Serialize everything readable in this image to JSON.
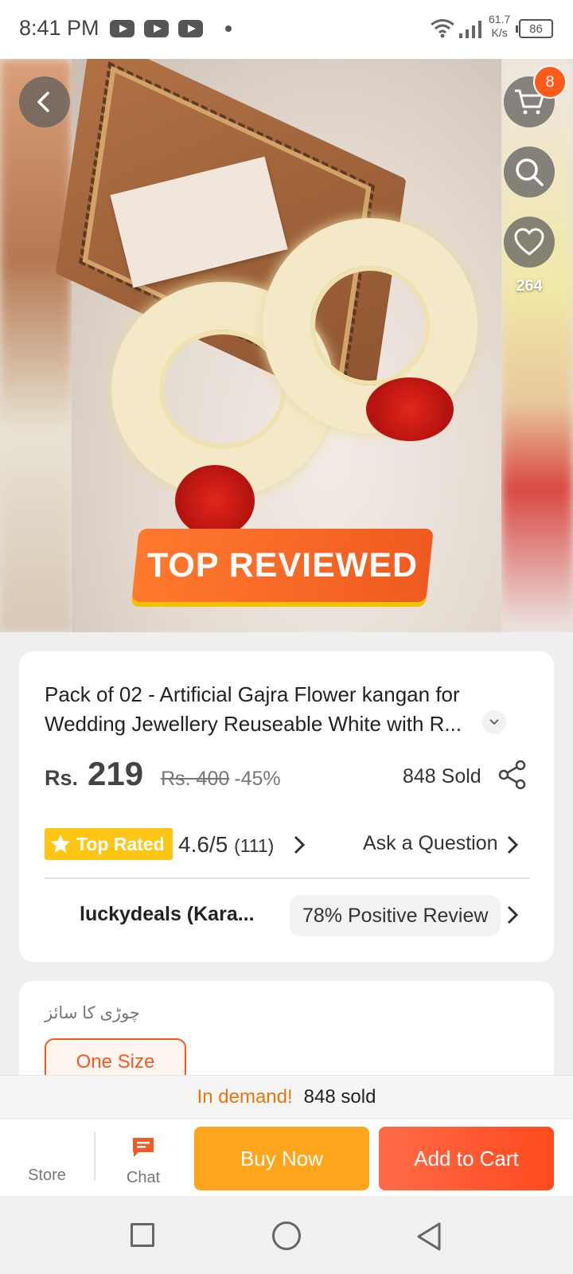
{
  "status_bar": {
    "time": "8:41 PM",
    "net_speed_value": "61.7",
    "net_speed_unit": "K/s",
    "battery": "86"
  },
  "hero": {
    "badge_text": "TOP REVIEWED",
    "cart_count": "8",
    "favorites_count": "264"
  },
  "product": {
    "title_line1": "Pack of 02 - Artificial Gajra Flower kangan for",
    "title_line2": "Wedding Jewellery Reuseable White with R...",
    "currency": "Rs.",
    "price": "219",
    "original_price": "Rs. 400",
    "discount": "-45%",
    "sold": "848 Sold"
  },
  "rating": {
    "badge": "Top Rated",
    "score": "4.6/5",
    "count": "(111)",
    "ask_label": "Ask a Question"
  },
  "seller": {
    "name": "luckydeals (Kara...",
    "positive_review": "78% Positive Review"
  },
  "variant": {
    "label": "چوڑی کا سائز",
    "option": "One Size"
  },
  "demand": {
    "label": "In demand!",
    "sold": "848 sold"
  },
  "action_bar": {
    "store_label": "Store",
    "chat_label": "Chat",
    "buy_now": "Buy Now",
    "add_to_cart": "Add to Cart"
  },
  "colors": {
    "accent_orange": "#f15a22",
    "buy_now": "#fea51b",
    "add_to_cart": "#ff4a1e",
    "top_rated": "#ffc515"
  }
}
